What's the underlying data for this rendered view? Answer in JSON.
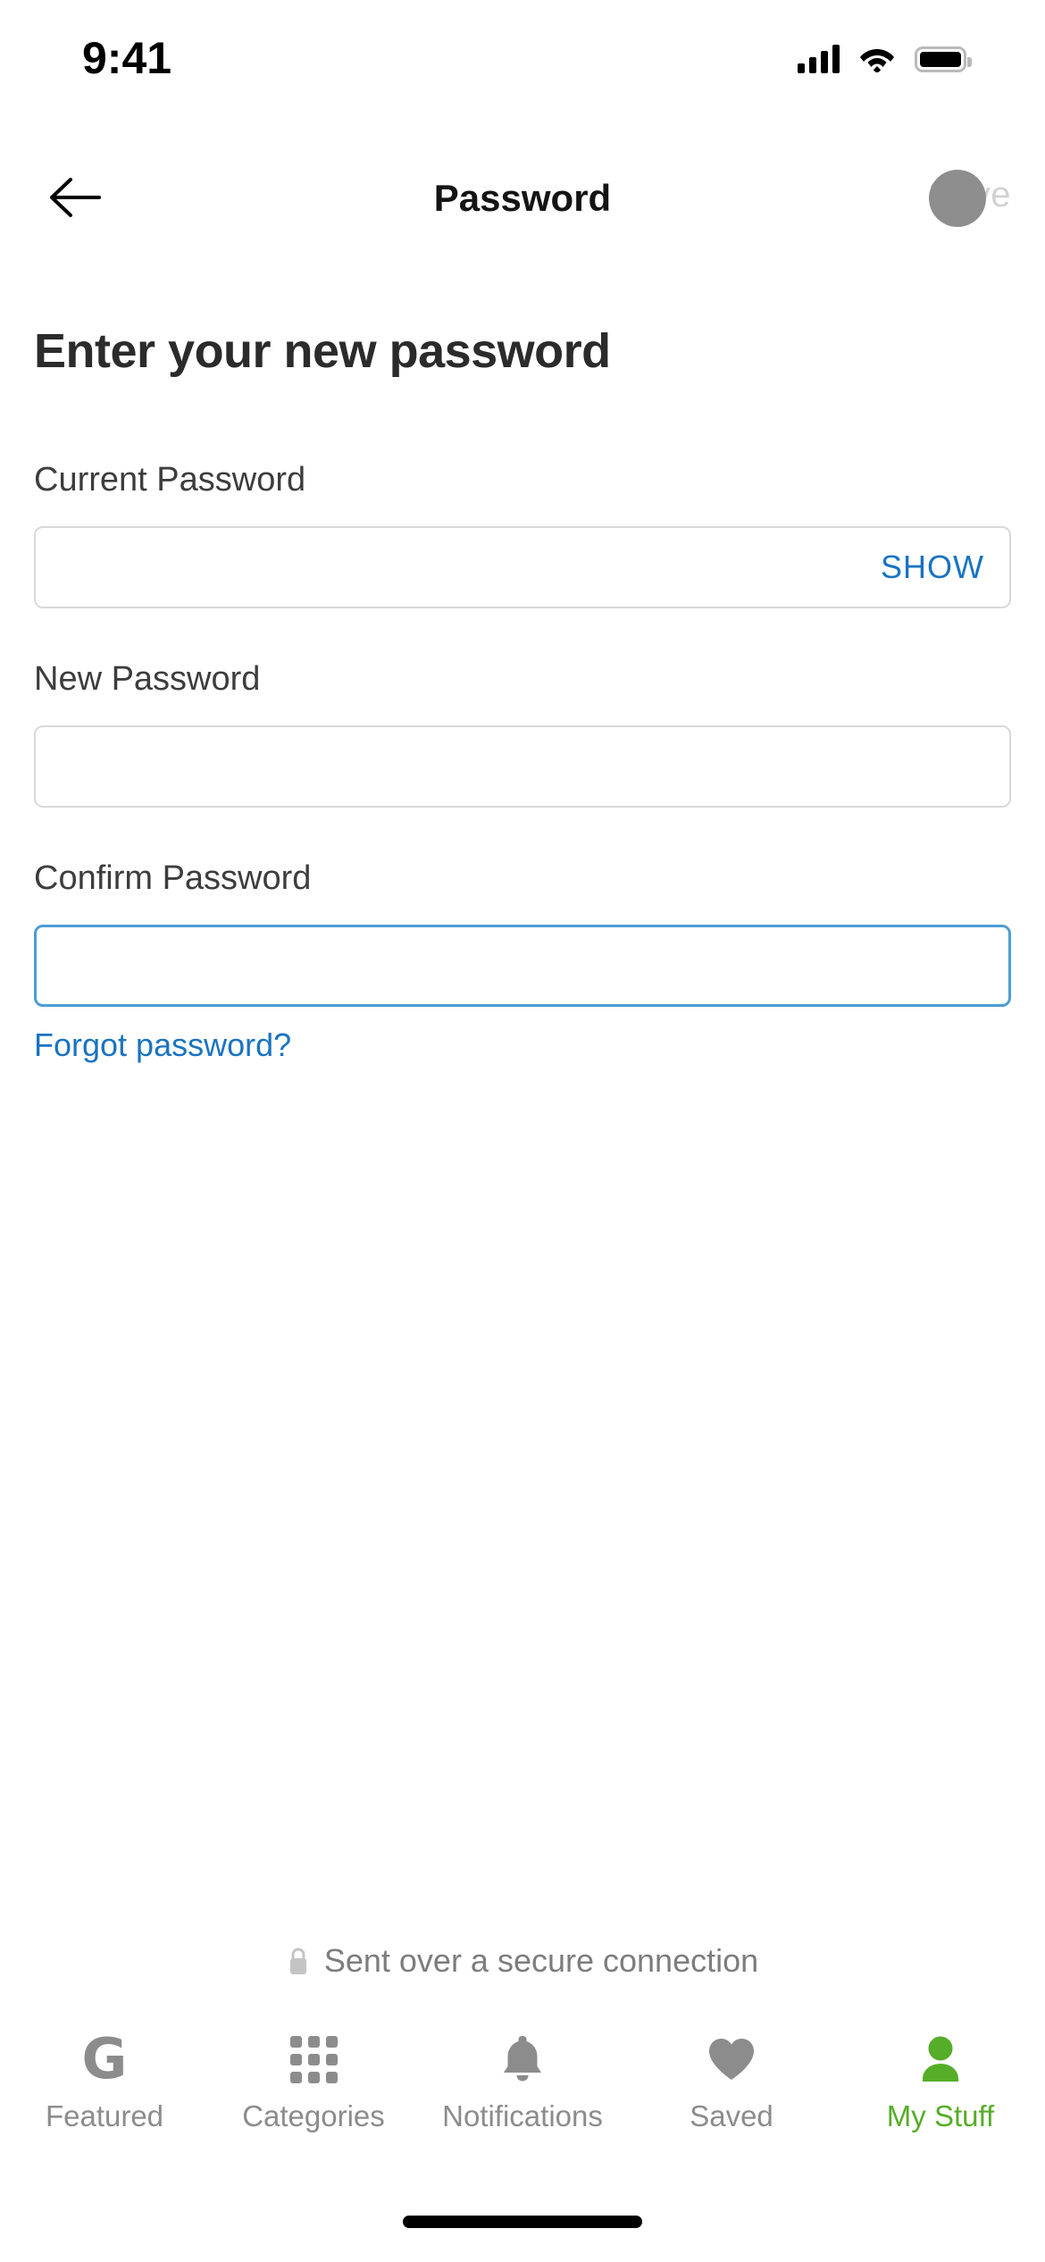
{
  "status_bar": {
    "time": "9:41",
    "cellular_icon": "cellular-signal-icon",
    "wifi_icon": "wifi-icon",
    "battery_icon": "battery-full-icon"
  },
  "nav": {
    "back_icon": "back-arrow-icon",
    "title": "Password",
    "save_label": "Save",
    "save_enabled": false,
    "spinner_color": "#8e8e8e"
  },
  "main": {
    "heading": "Enter your new password",
    "fields": [
      {
        "label": "Current Password",
        "value": "",
        "placeholder": "",
        "action_label": "SHOW",
        "focused": false
      },
      {
        "label": "New Password",
        "value": "",
        "placeholder": "",
        "action_label": "",
        "focused": false
      },
      {
        "label": "Confirm Password",
        "value": "",
        "placeholder": "",
        "action_label": "",
        "focused": true
      }
    ],
    "forgot_label": "Forgot password?"
  },
  "secure_note": {
    "icon": "lock-icon",
    "text": "Sent over a secure connection"
  },
  "tabbar": {
    "items": [
      {
        "label": "Featured",
        "icon": "g-logo-icon",
        "active": false
      },
      {
        "label": "Categories",
        "icon": "grid-icon",
        "active": false
      },
      {
        "label": "Notifications",
        "icon": "bell-icon",
        "active": false
      },
      {
        "label": "Saved",
        "icon": "heart-icon",
        "active": false
      },
      {
        "label": "My Stuff",
        "icon": "person-icon",
        "active": true
      }
    ]
  },
  "colors": {
    "link_blue": "#1a73c1",
    "focus_blue": "#4d9cd4",
    "accent_green": "#56ad28",
    "inactive_gray": "#8c8c8c",
    "border_gray": "#d9d9d9",
    "disabled_gray": "#d2d2d2"
  },
  "home_indicator": "home-indicator"
}
